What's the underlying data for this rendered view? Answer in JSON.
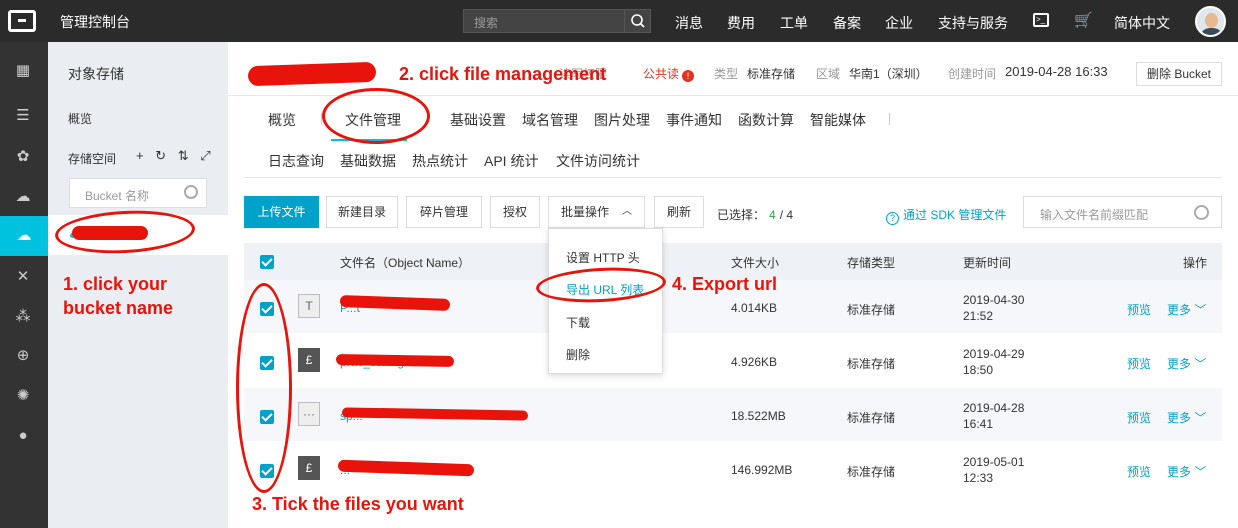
{
  "topbar": {
    "title": "管理控制台",
    "search_placeholder": "搜索",
    "nav": [
      "消息",
      "费用",
      "工单",
      "备案",
      "企业",
      "支持与服务"
    ],
    "language": "简体中文"
  },
  "sidebar": {
    "title": "对象存储",
    "overview": "概览",
    "storage_space": "存储空间",
    "space_icons": "+ ↻ ⇅ ⤢",
    "bucket_search_placeholder": "Bucket 名称"
  },
  "header": {
    "acl_label": "读写权限",
    "acl_value": "公共读",
    "type_label": "类型",
    "type_value": "标准存储",
    "region_label": "区域",
    "region_value": "华南1（深圳）",
    "created_label": "创建时间",
    "created_value": "2019-04-28 16:33",
    "delete_bucket": "删除 Bucket"
  },
  "tabs_row1": [
    "概览",
    "文件管理",
    "基础设置",
    "域名管理",
    "图片处理",
    "事件通知",
    "函数计算",
    "智能媒体"
  ],
  "tabs_row2": [
    "日志查询",
    "基础数据",
    "热点统计",
    "API 统计",
    "文件访问统计"
  ],
  "toolbar": {
    "upload": "上传文件",
    "new_dir": "新建目录",
    "fragments": "碎片管理",
    "authorize": "授权",
    "batch": "批量操作",
    "refresh": "刷新",
    "selected_label": "已选择：",
    "selected_count": "4",
    "selected_total": "/ 4",
    "sdk_link": "通过 SDK 管理文件",
    "prefix_placeholder": "输入文件名前缀匹配"
  },
  "table": {
    "headers": [
      "文件名（Object Name）",
      "文件大小",
      "存储类型",
      "更新时间",
      "操作"
    ],
    "rows": [
      {
        "name_partial": "P...t",
        "size": "4.014KB",
        "storage": "标准存储",
        "date": "2019-04-30",
        "time": "21:52",
        "icon": "T"
      },
      {
        "name_partial": "prac_still...g7",
        "size": "4.926KB",
        "storage": "标准存储",
        "date": "2019-04-29",
        "time": "18:50",
        "icon": "£"
      },
      {
        "name_partial": "sp...",
        "size": "18.522MB",
        "storage": "标准存储",
        "date": "2019-04-28",
        "time": "16:41",
        "icon": "···"
      },
      {
        "name_partial": "...",
        "size": "146.992MB",
        "storage": "标准存储",
        "date": "2019-05-01",
        "time": "12:33",
        "icon": "£"
      }
    ],
    "preview": "预览",
    "more": "更多"
  },
  "dropdown": {
    "items": [
      "设置 HTTP 头",
      "导出 URL 列表",
      "下载",
      "删除"
    ]
  },
  "annotations": {
    "a1": "1. click your bucket name",
    "a2": "2. click file management",
    "a3": "3. Tick the files you want",
    "a4": "4. Export url"
  },
  "colors": {
    "accent": "#00a2ca",
    "annotation_red": "#e8140b",
    "topbar": "#2b2b2b"
  }
}
